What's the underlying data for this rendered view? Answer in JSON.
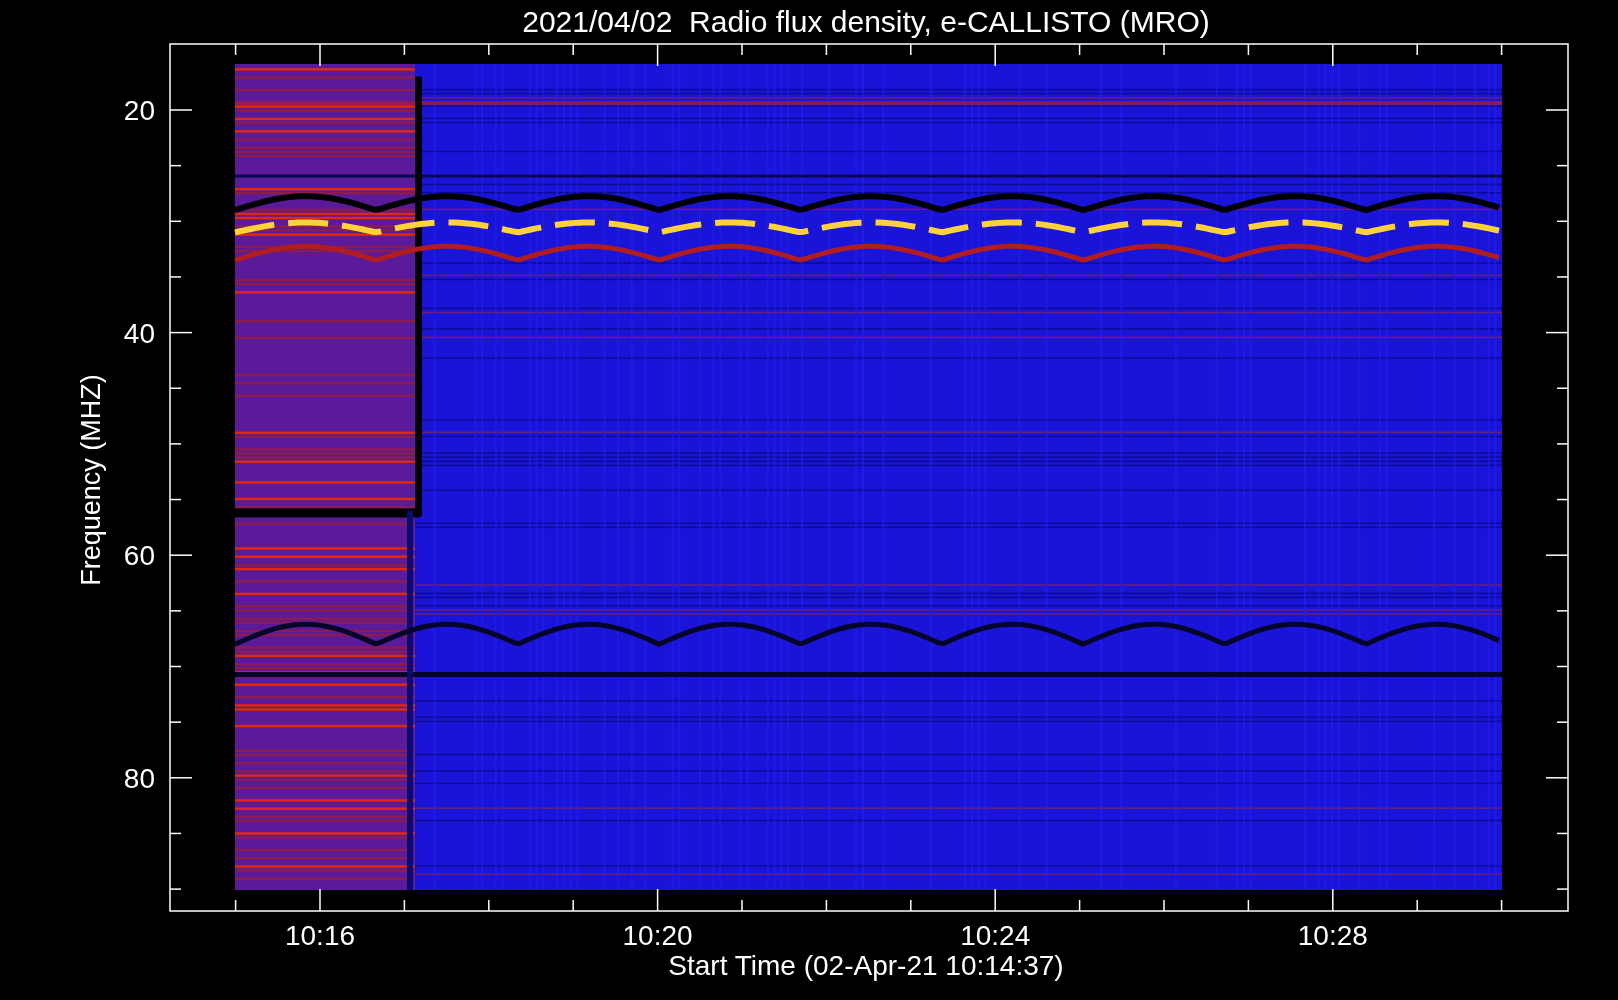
{
  "title": "2021/04/02  Radio flux density, e-CALLISTO (MRO)",
  "y_axis": {
    "label": "Frequency (MHZ)",
    "ticks": [
      "20",
      "40",
      "60",
      "80"
    ]
  },
  "x_axis": {
    "label": "Start Time (02-Apr-21 10:14:37)",
    "ticks": [
      "10:16",
      "10:20",
      "10:24",
      "10:28"
    ]
  }
}
